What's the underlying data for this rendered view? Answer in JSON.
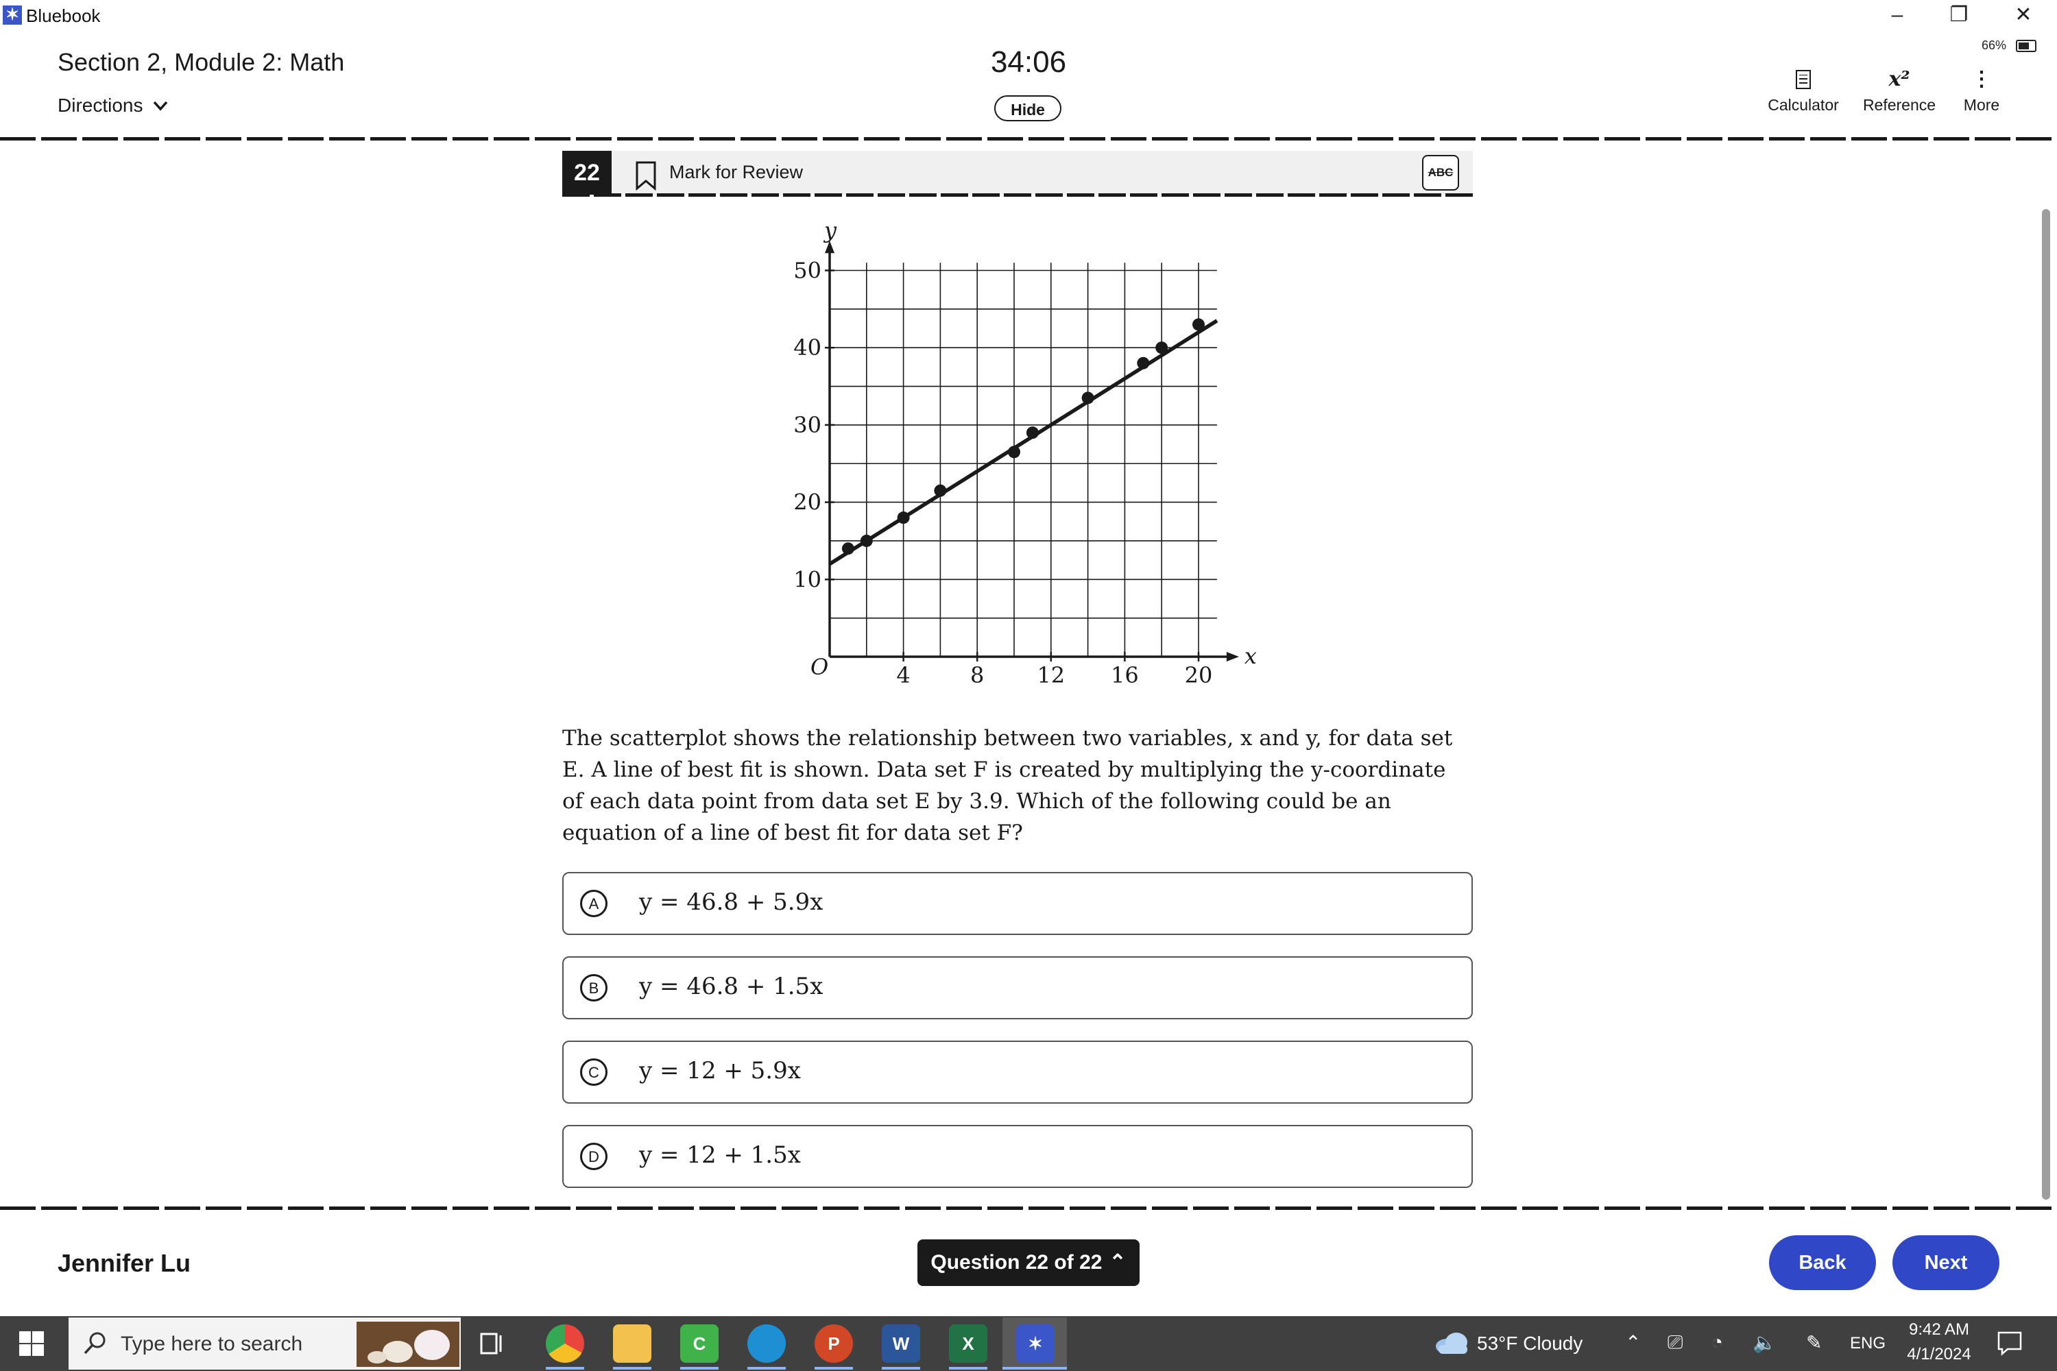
{
  "window": {
    "app_name": "Bluebook",
    "battery": "66%"
  },
  "header": {
    "section_title": "Section 2, Module 2: Math",
    "directions_label": "Directions",
    "timer": "34:06",
    "hide_label": "Hide",
    "tools": [
      {
        "label": "Calculator",
        "icon": "calculator-icon"
      },
      {
        "label": "Reference",
        "icon": "reference-icon",
        "glyph": "x²"
      },
      {
        "label": "More",
        "icon": "more-vertical-icon",
        "glyph": "⋮"
      }
    ]
  },
  "question": {
    "number": "22",
    "mark_for_review": "Mark for Review",
    "abc_label": "ABC",
    "stem": "The scatterplot shows the relationship between two variables, x and y, for data set E. A line of best fit is shown. Data set F is created by multiplying the y-coordinate of each data point from data set E by 3.9. Which of the following could be an equation of a line of best fit for data set F?",
    "choices": [
      {
        "letter": "A",
        "equation": "y = 46.8 + 5.9x"
      },
      {
        "letter": "B",
        "equation": "y = 46.8 + 1.5x"
      },
      {
        "letter": "C",
        "equation": "y = 12 + 5.9x"
      },
      {
        "letter": "D",
        "equation": "y = 12 + 1.5x"
      }
    ]
  },
  "chart_data": {
    "type": "scatter",
    "xlabel": "x",
    "ylabel": "y",
    "origin_label": "O",
    "xlim": [
      0,
      21
    ],
    "ylim": [
      0,
      51
    ],
    "x_ticks": [
      4,
      8,
      12,
      16,
      20
    ],
    "y_ticks": [
      10,
      20,
      30,
      40,
      50
    ],
    "grid": true,
    "points": [
      {
        "x": 1,
        "y": 14
      },
      {
        "x": 2,
        "y": 15
      },
      {
        "x": 4,
        "y": 18
      },
      {
        "x": 6,
        "y": 21.5
      },
      {
        "x": 10,
        "y": 26.5
      },
      {
        "x": 11,
        "y": 29
      },
      {
        "x": 14,
        "y": 33.5
      },
      {
        "x": 17,
        "y": 38
      },
      {
        "x": 18,
        "y": 40
      },
      {
        "x": 20,
        "y": 43
      }
    ],
    "best_fit_line": {
      "intercept": 12,
      "slope": 1.5,
      "x_range": [
        0,
        21
      ]
    }
  },
  "footer": {
    "student_name": "Jennifer Lu",
    "question_nav": "Question 22 of 22",
    "back_label": "Back",
    "next_label": "Next"
  },
  "taskbar": {
    "search_placeholder": "Type here to search",
    "apps": [
      {
        "name": "task-view-icon"
      },
      {
        "name": "chrome-icon",
        "color": "#e8453c"
      },
      {
        "name": "file-explorer-icon",
        "color": "#f2c14e"
      },
      {
        "name": "classroom-icon",
        "color": "#3fb24a",
        "glyph": "C"
      },
      {
        "name": "edge-icon",
        "color": "#1f8fd4"
      },
      {
        "name": "powerpoint-icon",
        "color": "#d24726",
        "glyph": "P"
      },
      {
        "name": "word-icon",
        "color": "#2b579a",
        "glyph": "W"
      },
      {
        "name": "excel-icon",
        "color": "#217346",
        "glyph": "X"
      },
      {
        "name": "bluebook-icon",
        "color": "#3a56c8",
        "glyph": "✶"
      }
    ],
    "weather": "53°F  Cloudy",
    "language": "ENG",
    "time": "9:42 AM",
    "date": "4/1/2024"
  }
}
